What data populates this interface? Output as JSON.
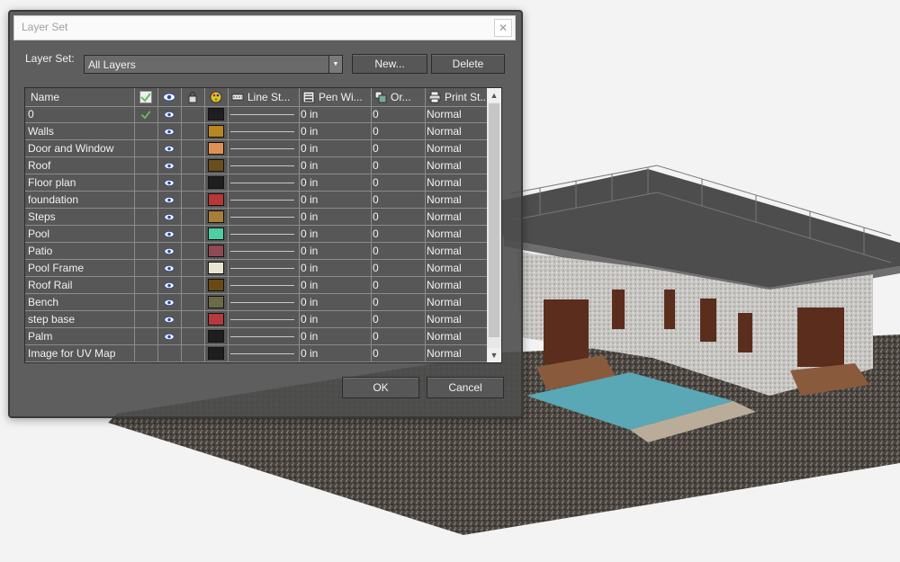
{
  "dialog": {
    "title": "Layer Set",
    "close_icon": "close-icon",
    "layer_set_label": "Layer Set:",
    "layer_set_value": "All Layers",
    "new_button": "New...",
    "delete_button": "Delete",
    "ok_button": "OK",
    "cancel_button": "Cancel"
  },
  "grid": {
    "columns": [
      {
        "label": "Name"
      },
      {
        "icon": "checkmark-icon"
      },
      {
        "icon": "eye-icon"
      },
      {
        "icon": "lock-icon"
      },
      {
        "icon": "color-palette-icon"
      },
      {
        "icon": "line-style-icon",
        "label": "Line St..."
      },
      {
        "icon": "pen-width-icon",
        "label": "Pen Wi..."
      },
      {
        "icon": "order-icon",
        "label": "Or..."
      },
      {
        "icon": "print-style-icon",
        "label": "Print St..."
      }
    ],
    "rows": [
      {
        "name": "0",
        "current": true,
        "visible": true,
        "color": "#1e1e1e",
        "pen": "0 in",
        "order": "0",
        "print": "Normal"
      },
      {
        "name": "Walls",
        "current": false,
        "visible": true,
        "color": "#b8861f",
        "pen": "0 in",
        "order": "0",
        "print": "Normal"
      },
      {
        "name": "Door and Window",
        "current": false,
        "visible": true,
        "color": "#dd9155",
        "pen": "0 in",
        "order": "0",
        "print": "Normal"
      },
      {
        "name": "Roof",
        "current": false,
        "visible": true,
        "color": "#6a4e1c",
        "pen": "0 in",
        "order": "0",
        "print": "Normal"
      },
      {
        "name": "Floor plan",
        "current": false,
        "visible": true,
        "color": "#1e1e1e",
        "pen": "0 in",
        "order": "0",
        "print": "Normal"
      },
      {
        "name": "foundation",
        "current": false,
        "visible": true,
        "color": "#b8383a",
        "pen": "0 in",
        "order": "0",
        "print": "Normal"
      },
      {
        "name": "Steps",
        "current": false,
        "visible": true,
        "color": "#a77f3a",
        "pen": "0 in",
        "order": "0",
        "print": "Normal"
      },
      {
        "name": "Pool",
        "current": false,
        "visible": true,
        "color": "#4fcea4",
        "pen": "0 in",
        "order": "0",
        "print": "Normal"
      },
      {
        "name": "Patio",
        "current": false,
        "visible": true,
        "color": "#8e4a52",
        "pen": "0 in",
        "order": "0",
        "print": "Normal"
      },
      {
        "name": "Pool Frame",
        "current": false,
        "visible": true,
        "color": "#e9e5d2",
        "pen": "0 in",
        "order": "0",
        "print": "Normal"
      },
      {
        "name": "Roof Rail",
        "current": false,
        "visible": true,
        "color": "#6a4a12",
        "pen": "0 in",
        "order": "0",
        "print": "Normal"
      },
      {
        "name": "Bench",
        "current": false,
        "visible": true,
        "color": "#6b6b48",
        "pen": "0 in",
        "order": "0",
        "print": "Normal"
      },
      {
        "name": "step base",
        "current": false,
        "visible": true,
        "color": "#b5393e",
        "pen": "0 in",
        "order": "0",
        "print": "Normal"
      },
      {
        "name": "Palm",
        "current": false,
        "visible": true,
        "color": "#1e1e1e",
        "pen": "0 in",
        "order": "0",
        "print": "Normal"
      },
      {
        "name": "Image for UV Map",
        "current": false,
        "visible": false,
        "color": "#1e1e1e",
        "pen": "0 in",
        "order": "0",
        "print": "Normal"
      }
    ]
  },
  "colors": {
    "dialog_bg": "#4e4e4e",
    "grid_bg": "#575757",
    "grid_lines": "#8c8c8c",
    "check_green": "#5fc05f",
    "eye_blue": "#2e4f9a"
  }
}
